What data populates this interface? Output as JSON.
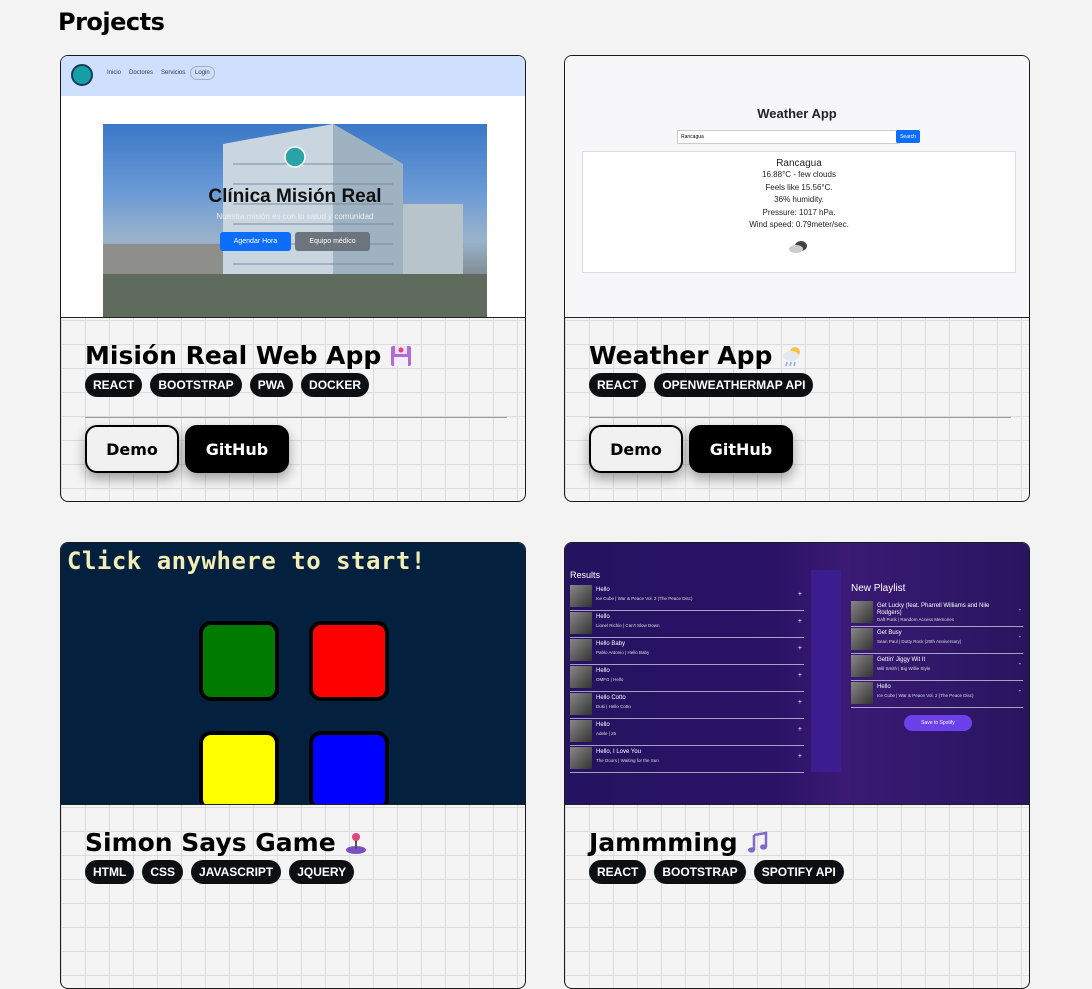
{
  "section_title": "Projects",
  "projects": [
    {
      "title": "Misión Real Web App",
      "emoji_icon": "floppy-disk-icon",
      "tags": [
        "REACT",
        "BOOTSTRAP",
        "PWA",
        "DOCKER"
      ],
      "demo_label": "Demo",
      "github_label": "GitHub",
      "preview": {
        "nav": [
          "Inicio",
          "Doctores",
          "Servicios"
        ],
        "login": "Login",
        "hero_title": "Clínica Misión Real",
        "hero_subtitle": "Nuestra misión es con tu salud y comunidad",
        "btn_primary": "Agendar Hora",
        "btn_secondary": "Equipo médico"
      }
    },
    {
      "title": "Weather App",
      "emoji_icon": "cloud-rain-sun-icon",
      "tags": [
        "REACT",
        "OPENWEATHERMAP API"
      ],
      "demo_label": "Demo",
      "github_label": "GitHub",
      "preview": {
        "heading": "Weather App",
        "input_value": "Rancagua",
        "search_label": "Search",
        "city": "Rancagua",
        "lines": [
          "16.88°C - few clouds",
          "Feels like 15.56°C.",
          "36% humidity.",
          "Pressure: 1017 hPa.",
          "Wind speed: 0.79meter/sec."
        ]
      }
    },
    {
      "title": "Simon Says Game",
      "emoji_icon": "joystick-icon",
      "tags": [
        "HTML",
        "CSS",
        "JAVASCRIPT",
        "JQUERY"
      ],
      "preview": {
        "title": "Click anywhere to start!",
        "colors": [
          "#007b00",
          "#ff0000",
          "#ffff00",
          "#0000ff"
        ]
      }
    },
    {
      "title": "Jammming",
      "emoji_icon": "music-notes-icon",
      "tags": [
        "REACT",
        "BOOTSTRAP",
        "SPOTIFY API"
      ],
      "preview": {
        "results_title": "Results",
        "playlist_title": "New Playlist",
        "save_label": "Save to Spotify",
        "results": [
          {
            "t": "Hello",
            "a": "Ice Cube | War & Peace Vol. 2 (The Peace Disc)"
          },
          {
            "t": "Hello",
            "a": "Lionel Richie | Can't Slow Down"
          },
          {
            "t": "Hello Baby",
            "a": "Pablo Antonio | Hello Baby"
          },
          {
            "t": "Hello",
            "a": "OMFG | Hello"
          },
          {
            "t": "Hello Cotto",
            "a": "Duki | Hello Cotto"
          },
          {
            "t": "Hello",
            "a": "Adele | 25"
          },
          {
            "t": "Hello, I Love You",
            "a": "The Doors | Waiting for the Sun"
          }
        ],
        "playlist": [
          {
            "t": "Get Lucky (feat. Pharrell Williams and Nile Rodgers)",
            "a": "Daft Punk | Random Access Memories"
          },
          {
            "t": "Get Busy",
            "a": "Sean Paul | Dutty Rock (20th Anniversary)"
          },
          {
            "t": "Gettin' Jiggy Wit It",
            "a": "Will Smith | Big Willie Style"
          },
          {
            "t": "Hello",
            "a": "Ice Cube | War & Peace Vol. 2 (The Peace Disc)"
          }
        ],
        "add_symbol": "+",
        "remove_symbol": "-"
      }
    }
  ]
}
